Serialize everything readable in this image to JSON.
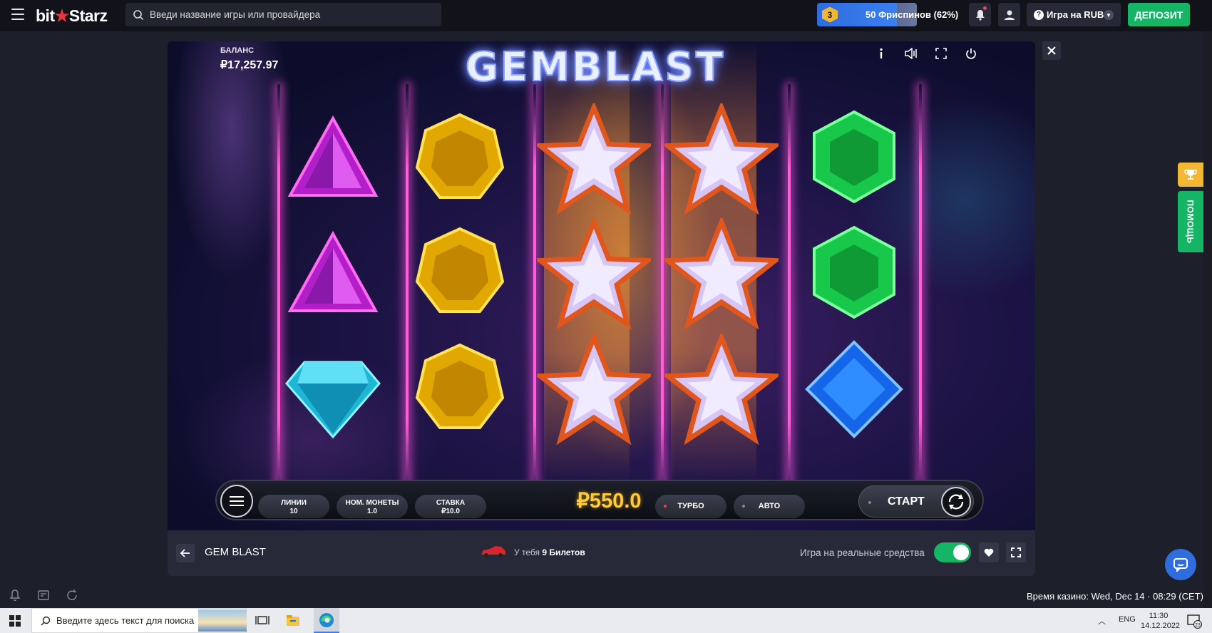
{
  "topbar": {
    "logo": {
      "part1": "bit",
      "star": "★",
      "part2": "Starz"
    },
    "search_placeholder": "Введи название игры или провайдера",
    "freespins": {
      "level": "3",
      "label": "50 Фриспинов (62%)",
      "progress": 0.62
    },
    "currency_label": "Игра на RUB",
    "deposit_label": "ДЕПОЗИТ"
  },
  "game": {
    "balance_label": "БАЛАНС",
    "balance_value": "₽17,257.97",
    "title": "GEMBLAST",
    "win_amount": "₽550.0",
    "controls": {
      "lines": {
        "label": "ЛИНИИ",
        "value": "10"
      },
      "coin": {
        "label": "НОМ. МОНЕТЫ",
        "value": "1.0"
      },
      "bet": {
        "label": "СТАВКА",
        "value": "₽10.0"
      },
      "turbo": "ТУРБО",
      "auto": "АВТО",
      "start": "СТАРТ"
    },
    "reels": [
      [
        "purple-triangle",
        "purple-triangle",
        "cyan-diamond"
      ],
      [
        "yellow-heptagon",
        "yellow-heptagon",
        "yellow-heptagon"
      ],
      [
        "star",
        "star",
        "star"
      ],
      [
        "star",
        "star",
        "star"
      ],
      [
        "green-hexagon",
        "green-hexagon",
        "blue-square"
      ]
    ]
  },
  "infobar": {
    "game_name": "GEM BLAST",
    "tickets_prefix": "У тебя",
    "tickets_count": "9 Билетов",
    "real_money_label": "Игра на реальные средства",
    "real_money_on": true
  },
  "side": {
    "help_label": "ПОМОЩЬ"
  },
  "status": {
    "casino_time": "Время казино: Wed, Dec 14 · 08:29 (CET)"
  },
  "taskbar": {
    "search_placeholder": "Введите здесь текст для поиска",
    "lang": "ENG",
    "time": "11:30",
    "date": "14.12.2022",
    "notifications": "23"
  },
  "colors": {
    "accent_green": "#16b566",
    "accent_blue": "#2f6ddf",
    "gold": "#f2b833",
    "neon_pink": "#ff5ed8"
  }
}
